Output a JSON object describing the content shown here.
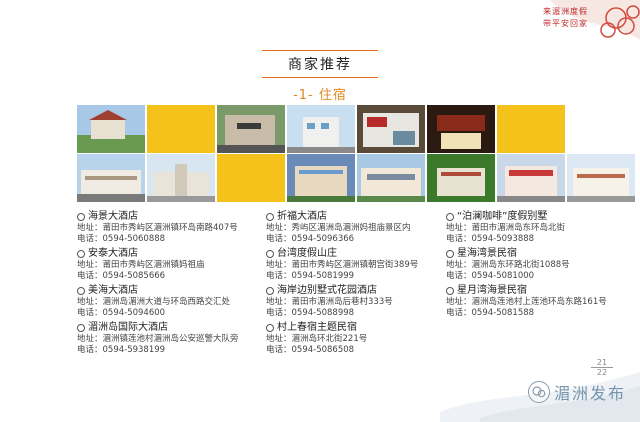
{
  "slogan": {
    "line1": "来湄洲度假",
    "line2": "带平安回家"
  },
  "title": "商家推荐",
  "subtitle": "-1- 住宿",
  "photos": {
    "row1": [
      "hotel-photo",
      "yellow-block",
      "hotel-photo",
      "hotel-photo",
      "hotel-photo",
      "hotel-photo",
      "yellow-block"
    ],
    "row2": [
      "hotel-photo",
      "hotel-photo",
      "yellow-block",
      "hotel-photo",
      "hotel-photo",
      "hotel-photo",
      "hotel-photo",
      "hotel-photo"
    ]
  },
  "columns": [
    [
      {
        "name": "海景大酒店",
        "address": "地址：莆田市秀屿区湄洲镇环岛南路407号",
        "phone": "电话：0594-5060888"
      },
      {
        "name": "安泰大酒店",
        "address": "地址：莆田市秀屿区湄洲镇妈祖庙",
        "phone": "电话：0594-5085666"
      },
      {
        "name": "美海大酒店",
        "address": "地址：湄洲岛湄洲大道与环岛西路交汇处",
        "phone": "电话：0594-5094600"
      },
      {
        "name": "湄洲岛国际大酒店",
        "address": "地址：湄洲镇莲池村湄洲岛公安巡警大队旁",
        "phone": "电话：0594-5938199"
      }
    ],
    [
      {
        "name": "折福大酒店",
        "address": "地址：秀屿区湄洲岛湄洲妈祖庙景区内",
        "phone": "电话：0594-5096366"
      },
      {
        "name": "台湾度假山庄",
        "address": "地址：莆田市秀屿区湄洲镇朝宫街389号",
        "phone": "电话：0594-5081999"
      },
      {
        "name": "海岸边别墅式花园酒店",
        "address": "地址：莆田市湄洲岛后巷村333号",
        "phone": "电话：0594-5088998"
      },
      {
        "name": "村上春宿主题民宿",
        "address": "地址：湄洲岛环北街221号",
        "phone": "电话：0594-5086508"
      }
    ],
    [
      {
        "name": "“泊澜咖啡”度假别墅",
        "address": "地址：莆田市湄洲岛东环岛北街",
        "phone": "电话：0594-5093888"
      },
      {
        "name": "星海湾景民宿",
        "address": "地址：湄洲岛东环路北街1088号",
        "phone": "电话：0594-5081000"
      },
      {
        "name": "星月湾海景民宿",
        "address": "地址：湄洲岛莲池村上莲池环岛东路161号",
        "phone": "电话：0594-5081588"
      }
    ]
  ],
  "page": {
    "current": "21",
    "total": "22"
  },
  "watermark": "湄洲发布",
  "colors": {
    "accent": "#e08820",
    "title_rule": "#e07020",
    "slogan": "#c0282a",
    "yellow_block": "#f5c11b"
  }
}
